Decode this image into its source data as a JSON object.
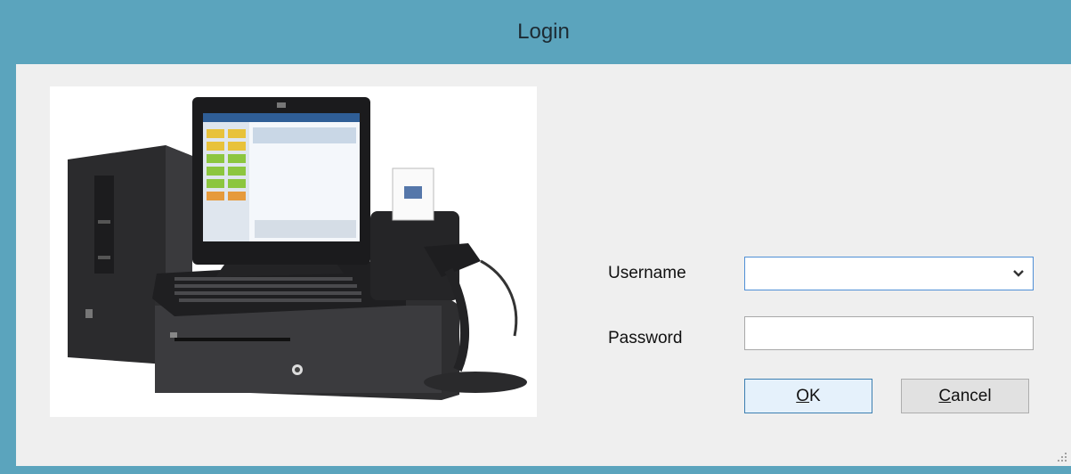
{
  "window": {
    "title": "Login"
  },
  "form": {
    "username_label": "Username",
    "password_label": "Password",
    "username_value": "",
    "password_value": ""
  },
  "buttons": {
    "ok_mnemonic": "O",
    "ok_rest": "K",
    "cancel_mnemonic": "C",
    "cancel_rest": "ancel"
  },
  "colors": {
    "titlebar": "#5ba4bd",
    "client": "#efefef",
    "focus_border": "#4f8fd6"
  },
  "icons": {
    "combo_arrow": "chevron-down-icon",
    "grip": "resize-grip-icon"
  }
}
